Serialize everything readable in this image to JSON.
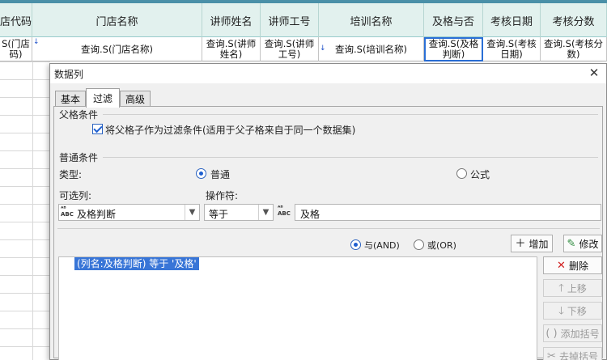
{
  "sheet": {
    "headers": [
      "店代码",
      "门店名称",
      "讲师姓名",
      "讲师工号",
      "培训名称",
      "及格与否",
      "考核日期",
      "考核分数"
    ],
    "row": [
      "S(门店码)",
      "查询.S(门店名称)",
      "查询.S(讲师姓名)",
      "查询.S(讲师工号)",
      "查询.S(培训名称)",
      "查询.S(及格判断)",
      "查询.S(考核日期)",
      "查询.S(考核分数)"
    ]
  },
  "dialog": {
    "title": "数据列",
    "tabs": [
      "基本",
      "过滤",
      "高级"
    ],
    "active_tab": "过滤",
    "parent_section": "父格条件",
    "parent_checkbox_label": "将父格子作为过滤条件(适用于父子格来自于同一个数据集)",
    "normal_section": "普通条件",
    "type_label": "类型:",
    "type_normal": "普通",
    "type_formula": "公式",
    "column_label": "可选列:",
    "column_value": "及格判断",
    "operator_label": "操作符:",
    "operator_value": "等于",
    "value_text": "及格",
    "and_label": "与(AND)",
    "or_label": "或(OR)",
    "add_button": "增加",
    "modify_button": "修改",
    "delete_button": "删除",
    "up_button": "上移",
    "down_button": "下移",
    "add_bracket_button": "添加括号",
    "remove_bracket_button": "去掉括号",
    "conditions": [
      "(列名:及格判断) 等于 '及格'"
    ]
  },
  "colors": {
    "header_bg": "#e2f1ee",
    "selection": "#3875d7",
    "accent": "#1e5fd0"
  }
}
